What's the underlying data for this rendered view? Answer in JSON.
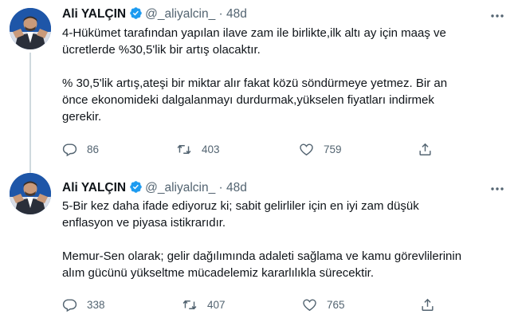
{
  "tweets": [
    {
      "author_name": "Ali YALÇIN",
      "handle": "@_aliyalcin_",
      "separator": "·",
      "time": "48d",
      "text": "4-Hükümet tarafından yapılan ilave zam ile birlikte,ilk altı ay için maaş ve\nücretlerde %30,5'lik bir artış olacaktır.\n\n% 30,5'lik artış,ateşi bir miktar alır fakat közü söndürmeye yetmez. Bir an\nönce ekonomideki dalgalanmayı durdurmak,yükselen fiyatları indirmek\ngerekir.",
      "replies": "86",
      "retweets": "403",
      "likes": "759"
    },
    {
      "author_name": "Ali YALÇIN",
      "handle": "@_aliyalcin_",
      "separator": "·",
      "time": "48d",
      "text": "5-Bir kez daha ifade ediyoruz ki; sabit gelirliler için en iyi zam düşük\nenflasyon ve piyasa istikrarıdır.\n\nMemur-Sen olarak; gelir dağılımında adaleti sağlama ve kamu görevlilerinin\nalım gücünü yükseltme mücadelemiz kararlılıkla sürecektir.",
      "replies": "338",
      "retweets": "407",
      "likes": "765"
    }
  ],
  "colors": {
    "muted": "#536471",
    "verified": "#1d9bf0",
    "thread_line": "#cfd9de"
  },
  "icons": [
    "reply-icon",
    "retweet-icon",
    "like-icon",
    "share-icon",
    "more-icon",
    "verified-badge-icon"
  ]
}
